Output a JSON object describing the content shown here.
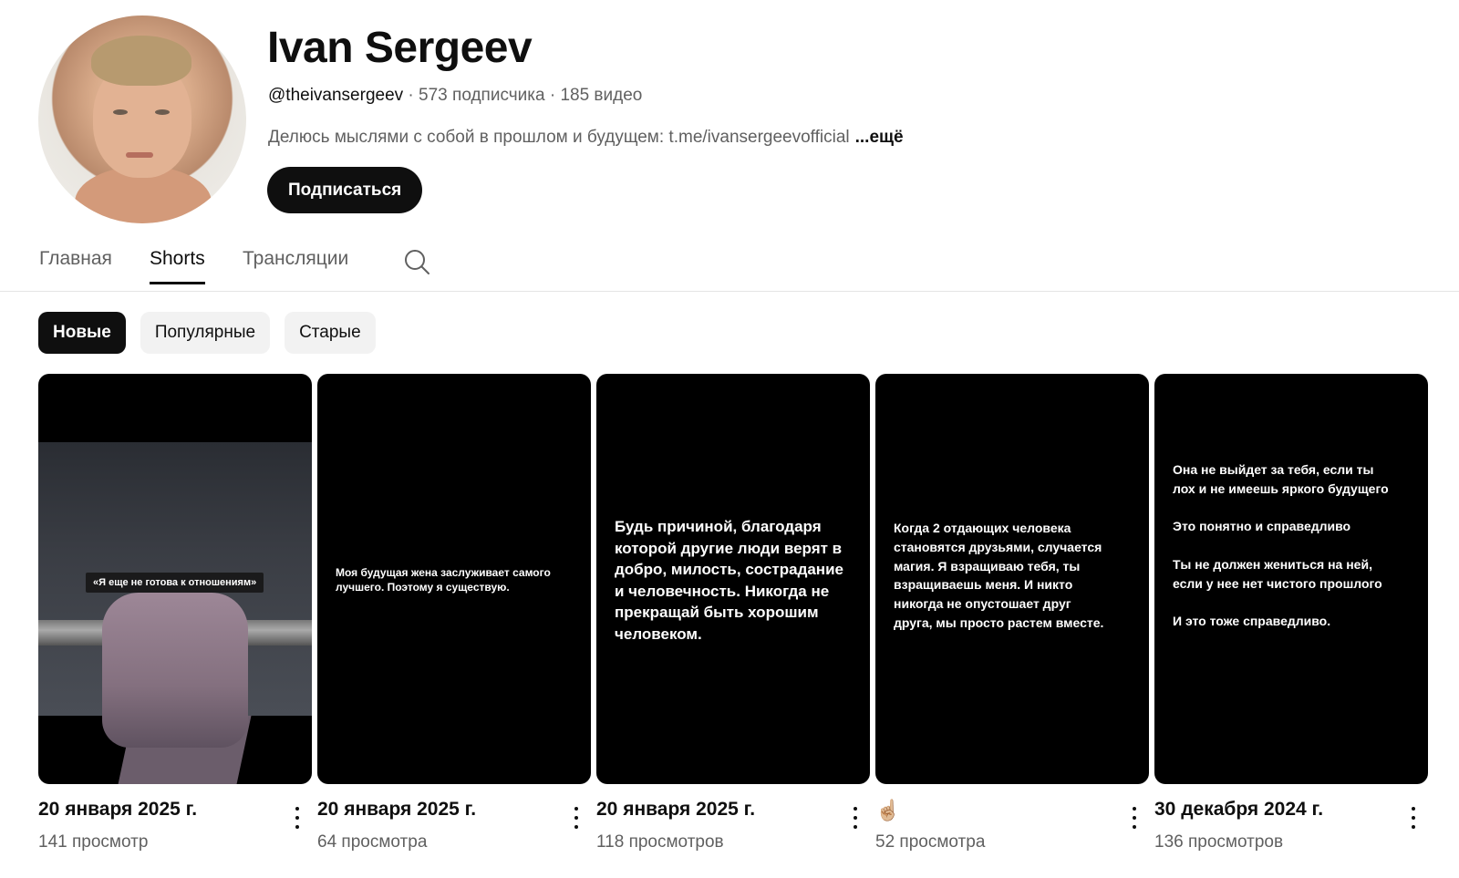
{
  "channel": {
    "name": "Ivan Sergeev",
    "handle": "@theivansergeev",
    "subscribers": "573 подписчика",
    "videos": "185 видео",
    "separator": " · ",
    "description": "Делюсь мыслями с собой в прошлом и будущем: t.me/ivansergeevofficial",
    "more_label": "...ещё",
    "subscribe_label": "Подписаться"
  },
  "tabs": [
    {
      "label": "Главная",
      "active": false
    },
    {
      "label": "Shorts",
      "active": true
    },
    {
      "label": "Трансляции",
      "active": false
    }
  ],
  "icons": {
    "tab_search": "search-icon",
    "more": "more-vert-icon"
  },
  "chips": [
    {
      "label": "Новые",
      "active": true
    },
    {
      "label": "Популярные",
      "active": false
    },
    {
      "label": "Старые",
      "active": false
    }
  ],
  "shorts": [
    {
      "title": "20 января 2025 г.",
      "views": "141 просмотр",
      "overlay_text": "«Я еще не готова к отношениям»"
    },
    {
      "title": "20 января 2025 г.",
      "views": "64 просмотра",
      "overlay_text": "Моя будущая жена заслуживает самого\nлучшего. Поэтому я существую."
    },
    {
      "title": "20 января 2025 г.",
      "views": "118 просмотров",
      "overlay_text": "Будь причиной, благодаря\nкоторой другие люди верят в\nдобро, милость, сострадание\nи человечность. Никогда не\nпрекращай быть хорошим\nчеловеком."
    },
    {
      "title": "☝🏼",
      "views": "52 просмотра",
      "overlay_text": "Когда 2 отдающих человека\nстановятся друзьями, случается\nмагия. Я взращиваю тебя, ты\nвзращиваешь меня. И никто\nникогда не опустошает друг\nдруга, мы просто растем вместе."
    },
    {
      "title": "30 декабря 2024 г.",
      "views": "136 просмотров",
      "overlay_text": "Она не выйдет за тебя, если ты\nлох и не имеешь яркого будущего\n\nЭто понятно и справедливо\n\nТы не должен жениться на ней,\nесли у нее нет чистого прошлого\n\nИ это тоже справедливо."
    }
  ]
}
